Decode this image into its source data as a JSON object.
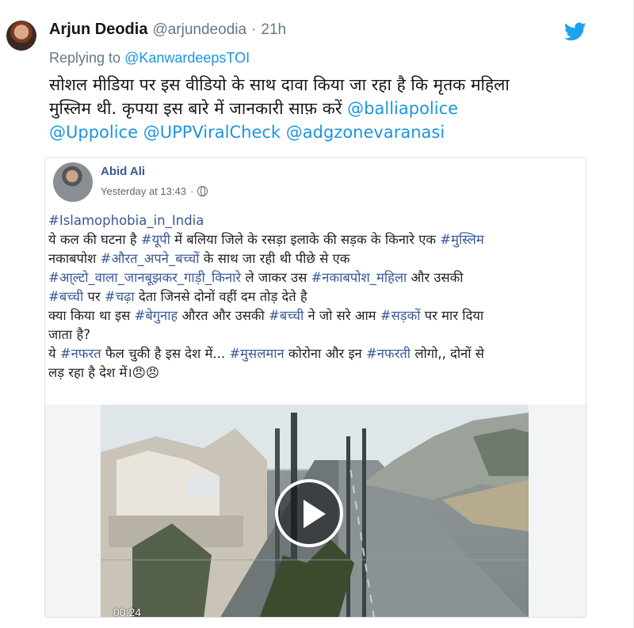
{
  "tweet": {
    "author_name": "Arjun Deodia",
    "author_handle": "@arjundeodia",
    "separator": "·",
    "time": "21h",
    "replying_prefix": "Replying to",
    "replying_to": "@KanwardeepsTOI",
    "text_line1": "सोशल मीडिया पर इस वीडियो के साथ दावा किया जा रहा है कि मृतक महिला",
    "text_line2_plain": "मुस्लिम थी. कृपया इस बारे में जानकारी साफ़ करें",
    "mentions": [
      "@balliapolice",
      "@Uppolice",
      "@UPPViralCheck",
      "@adgzonevaranasi"
    ],
    "icons": {
      "brand": "twitter-bird-icon"
    },
    "colors": {
      "link": "#1b95e0",
      "brand": "#1da1f2",
      "muted": "#657786"
    }
  },
  "fb_post": {
    "author_name": "Abid Ali",
    "timestamp": "Yesterday at 13:43",
    "separator": "·",
    "hashtag_top": "#Islamophobia_in_India",
    "l1_a": "ये कल की घटना है ",
    "l1_tag1": "#यूपी",
    "l1_b": " में बलिया जिले के रसड़ा इलाके की सड़क के किनारे एक ",
    "l1_tag2": "#मुस्लिम",
    "l2_a": "नकाबपोश ",
    "l2_tag1": "#औरत_अपने_बच्चों",
    "l2_b": " के साथ जा रही थी पीछे से एक",
    "l3_tag1": "#आ्ल्टो_वाला_जानबूझकर_गाड़ी_किनारे",
    "l3_b": " ले जाकर उस ",
    "l3_tag2": "#नकाबपोश_महिला",
    "l3_c": " और उसकी",
    "l4_tag1": "#बच्ची",
    "l4_a": " पर ",
    "l4_tag2": "#चढ़ा",
    "l4_b": " देता जिनसे दोनों वहीं दम तोड़ देते है",
    "l5_a": "क्या किया था इस ",
    "l5_tag1": "#बेगुनाह",
    "l5_b": " औरत और उसकी ",
    "l5_tag2": "#बच्ची",
    "l5_c": " ने जो सरे आम ",
    "l5_tag3": "#सड़कों",
    "l5_d": " पर मार दिया",
    "l6": "जाता है?",
    "l7_a": "ये ",
    "l7_tag1": "#नफरत",
    "l7_b": " फैल चुकी है इस देश में... ",
    "l7_tag2": "#मुसलमान",
    "l7_c": " कोरोना और इन ",
    "l7_tag3": "#नफरती",
    "l7_d": " लोगो,, दोनों से",
    "l8": "लड़ रहा है देश में।",
    "emoji": "😠😠",
    "icons": {
      "privacy": "globe-icon",
      "video": "play-icon"
    },
    "video_duration": "00:24",
    "colors": {
      "link": "#385898",
      "meta": "#616770"
    }
  }
}
